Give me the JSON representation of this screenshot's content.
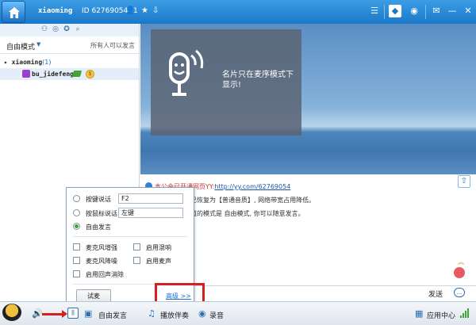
{
  "titlebar": {
    "username": "xiaoming",
    "id_text": "ID 62769054",
    "user_count": "1",
    "icons": [
      "home-icon",
      "person-icon",
      "star-icon",
      "download-icon",
      "list-icon",
      "channel-icon",
      "game-icon",
      "mail-icon",
      "minimize-icon",
      "close-icon"
    ]
  },
  "sidebar": {
    "mode_label": "自由模式",
    "mode_note": "所有人可以发言",
    "root_name": "xiaoming",
    "root_count": "(1)",
    "user_name": "bu_jidefengs"
  },
  "video": {
    "placard_text": "名片只在麦序模式下显示!"
  },
  "chat": {
    "line1_prefix": "本公会已开通网页YY:",
    "line1_link": "http://yy.com/62769054",
    "line2": "已恢复为【普通音质】, 网络带宽占用降低。",
    "line3": "道的模式是 自由模式, 你可以随意发言。",
    "send_label": "发送"
  },
  "popup": {
    "opt_hotkey": "按键说话",
    "opt_hotkey_value": "F2",
    "opt_mouse": "按鼠标说话",
    "opt_mouse_value": "左键",
    "opt_free": "自由发言",
    "chk_mic_boost": "麦克风增强",
    "chk_reverb": "启用混响",
    "chk_mic_noise": "麦克风降噪",
    "chk_karaoke": "启用麦声",
    "chk_echo": "启用回声消除",
    "try_label": "试麦",
    "advanced_label": "高级 >>",
    "selected": "自由发言"
  },
  "bottombar": {
    "free_speech": "自由发言",
    "play_music": "播放伴奏",
    "record": "录音",
    "app_center": "应用中心"
  },
  "colors": {
    "accent": "#1a78c9",
    "highlight": "#d62020",
    "free_radio": "#3aa63a"
  }
}
